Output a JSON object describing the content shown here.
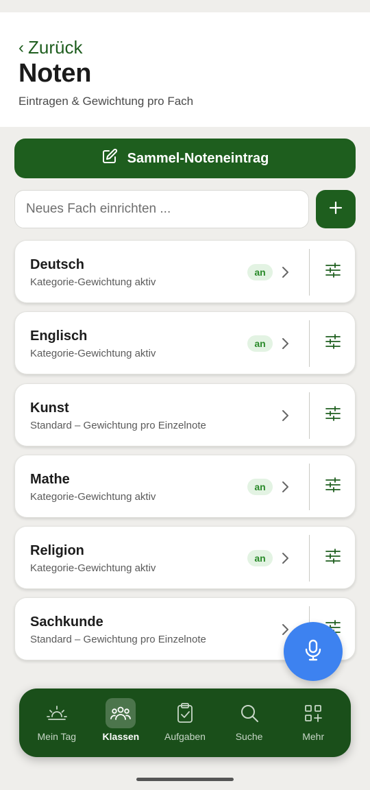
{
  "header": {
    "back_label": "Zurück",
    "title": "Noten",
    "subtitle": "Eintragen & Gewichtung pro Fach"
  },
  "bulk_button": {
    "label": "Sammel-Noteneintrag",
    "icon": "edit-icon"
  },
  "new_subject": {
    "placeholder": "Neues Fach einrichten ...",
    "value": ""
  },
  "subjects": [
    {
      "name": "Deutsch",
      "description": "Kategorie-Gewichtung aktiv",
      "badge": "an"
    },
    {
      "name": "Englisch",
      "description": "Kategorie-Gewichtung aktiv",
      "badge": "an"
    },
    {
      "name": "Kunst",
      "description": "Standard – Gewichtung pro Einzelnote",
      "badge": ""
    },
    {
      "name": "Mathe",
      "description": "Kategorie-Gewichtung aktiv",
      "badge": "an"
    },
    {
      "name": "Religion",
      "description": "Kategorie-Gewichtung aktiv",
      "badge": "an"
    },
    {
      "name": "Sachkunde",
      "description": "Standard – Gewichtung pro Einzelnote",
      "badge": ""
    }
  ],
  "nav": {
    "items": [
      {
        "label": "Mein Tag",
        "icon": "sunrise-icon",
        "active": false
      },
      {
        "label": "Klassen",
        "icon": "group-icon",
        "active": true
      },
      {
        "label": "Aufgaben",
        "icon": "clipboard-check-icon",
        "active": false
      },
      {
        "label": "Suche",
        "icon": "search-icon",
        "active": false
      },
      {
        "label": "Mehr",
        "icon": "grid-plus-icon",
        "active": false
      }
    ]
  },
  "colors": {
    "primary": "#1e5e1e",
    "nav_bg": "#1a4f1a",
    "badge_bg": "#e3f3e3",
    "badge_text": "#2a8a2a",
    "mic": "#3d82f0",
    "background": "#efeeeb"
  }
}
